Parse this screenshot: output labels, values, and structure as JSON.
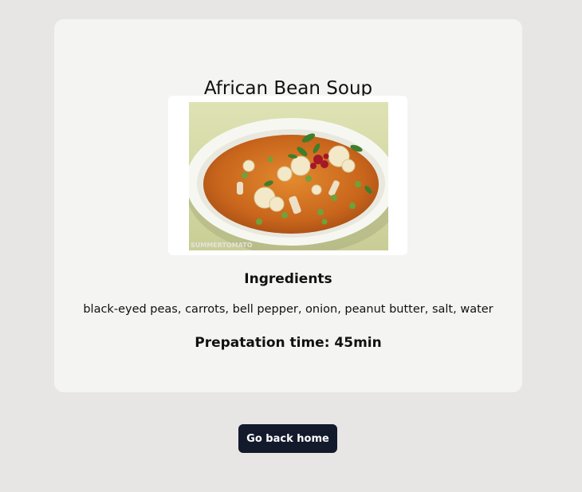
{
  "recipe": {
    "title": "African Bean Soup",
    "image_watermark": "SUMMERTOMATO",
    "ingredients_heading": "Ingredients",
    "ingredients_text": "black-eyed peas, carrots, bell pepper, onion, peanut butter, salt, water",
    "prep_time": "Prepatation time: 45min"
  },
  "actions": {
    "go_back_label": "Go back home"
  },
  "colors": {
    "page_bg": "#e7e6e4",
    "card_bg": "#f4f4f2",
    "button_bg": "#131a2c",
    "button_text": "#ffffff"
  }
}
